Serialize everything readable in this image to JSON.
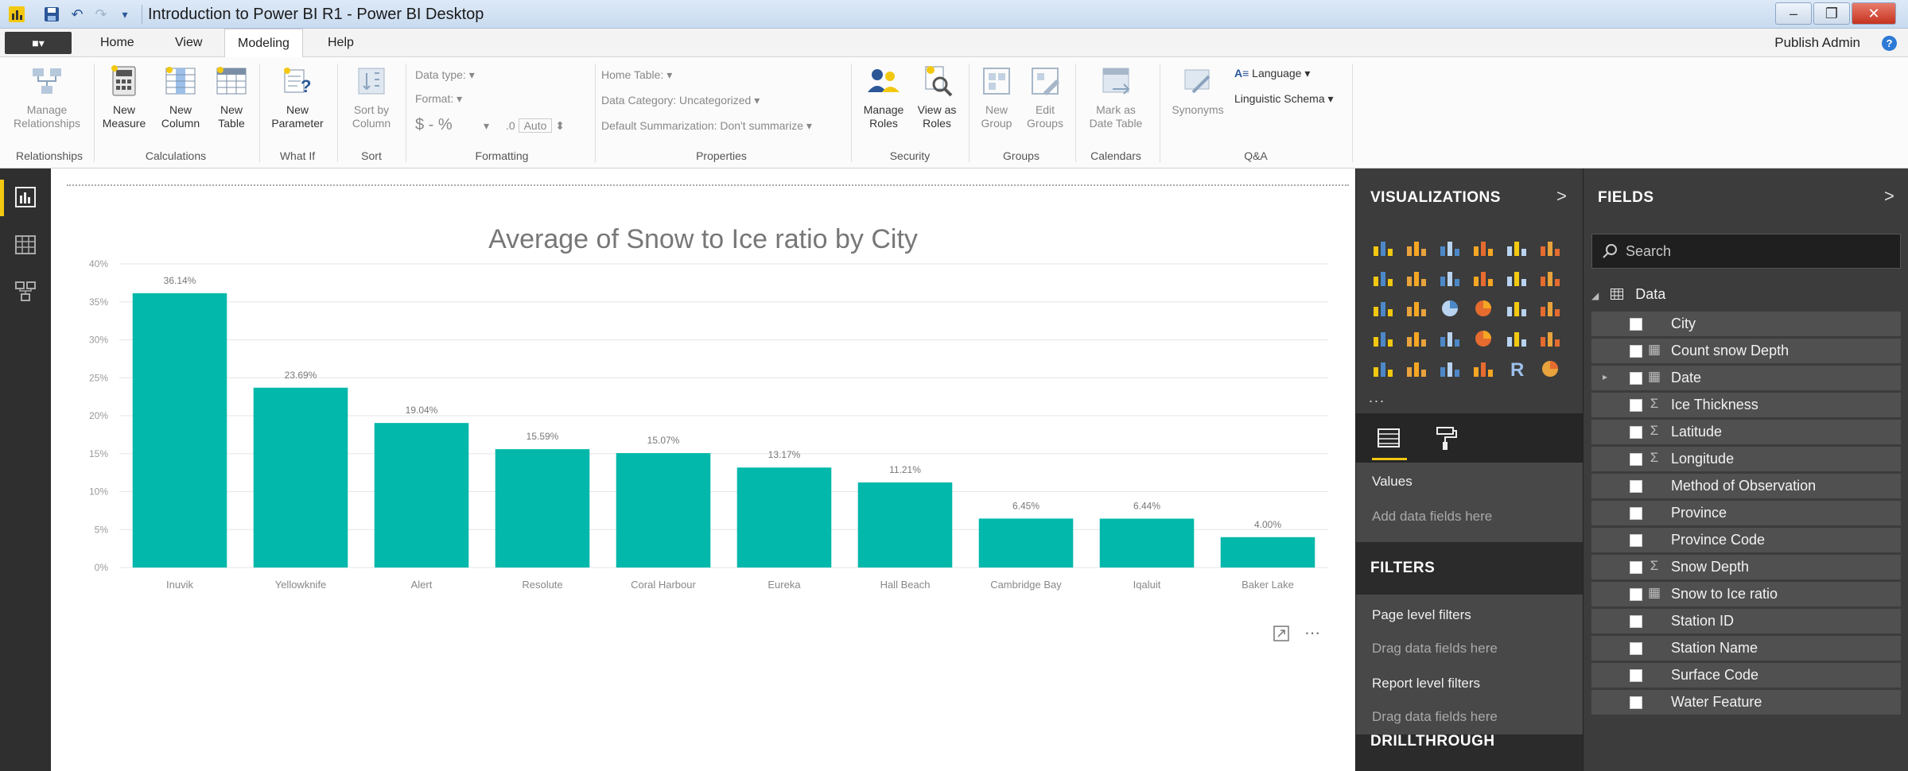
{
  "window": {
    "title": "Introduction to Power BI R1 - Power BI Desktop"
  },
  "menu": {
    "file_label": "■▾",
    "tabs": [
      {
        "label": "Home",
        "active": false
      },
      {
        "label": "View",
        "active": false
      },
      {
        "label": "Modeling",
        "active": true
      },
      {
        "label": "Help",
        "active": false
      }
    ],
    "publisher": "Publish Admin",
    "help_glyph": "?"
  },
  "ribbon": {
    "buttons": {
      "manage_relationships": "Manage\nRelationships",
      "new_measure": "New\nMeasure",
      "new_column": "New\nColumn",
      "new_table": "New\nTable",
      "new_parameter": "New\nParameter",
      "sort_by_column": "Sort by\nColumn",
      "manage_roles": "Manage\nRoles",
      "view_as_roles": "View as\nRoles",
      "new_group": "New\nGroup",
      "edit_groups": "Edit\nGroups",
      "mark_as_date_table": "Mark as\nDate Table",
      "synonyms": "Synonyms",
      "language": "Language",
      "linguistic_schema": "Linguistic Schema"
    },
    "formatting": {
      "data_type": "Data type:",
      "format": "Format:",
      "currency": "$ - %",
      "auto": "Auto"
    },
    "properties": {
      "home_table": "Home Table:",
      "data_category": "Data Category: Uncategorized",
      "default_summarization": "Default Summarization: Don't summarize"
    },
    "groups": {
      "relationships": "Relationships",
      "calculations": "Calculations",
      "what_if": "What If",
      "sort": "Sort",
      "formatting": "Formatting",
      "properties": "Properties",
      "security": "Security",
      "groups": "Groups",
      "calendars": "Calendars",
      "qa": "Q&A"
    }
  },
  "chart_data": {
    "type": "bar",
    "title": "Average of Snow to Ice ratio by City",
    "categories": [
      "Inuvik",
      "Yellowknife",
      "Alert",
      "Resolute",
      "Coral Harbour",
      "Eureka",
      "Hall Beach",
      "Cambridge Bay",
      "Iqaluit",
      "Baker Lake"
    ],
    "values": [
      36.14,
      23.69,
      19.04,
      15.59,
      15.07,
      13.17,
      11.21,
      6.45,
      6.44,
      4.0
    ],
    "data_labels": [
      "36.14%",
      "23.69%",
      "19.04%",
      "15.59%",
      "15.07%",
      "13.17%",
      "11.21%",
      "6.45%",
      "6.44%",
      "4.00%"
    ],
    "y_ticks": [
      0,
      5,
      10,
      15,
      20,
      25,
      30,
      35,
      40
    ],
    "y_tick_labels": [
      "0%",
      "5%",
      "10%",
      "15%",
      "20%",
      "25%",
      "30%",
      "35%",
      "40%"
    ],
    "ylim": [
      0,
      40
    ],
    "grid": true,
    "bar_color": "#01b8aa"
  },
  "visualizations": {
    "header": "VISUALIZATIONS",
    "chevron": ">",
    "more": "...",
    "values_label": "Values",
    "values_hint": "Add data fields here",
    "filters_header": "FILTERS",
    "page_filters": "Page level filters",
    "page_filters_hint": "Drag data fields here",
    "report_filters": "Report level filters",
    "report_filters_hint": "Drag data fields here",
    "drillthrough_header": "DRILLTHROUGH"
  },
  "fields": {
    "header": "FIELDS",
    "chevron": ">",
    "search_placeholder": "Search",
    "table_name": "Data",
    "items": [
      {
        "name": "City",
        "type": "",
        "expandable": false
      },
      {
        "name": "Count snow Depth",
        "type": "calc",
        "expandable": false
      },
      {
        "name": "Date",
        "type": "date",
        "expandable": true
      },
      {
        "name": "Ice Thickness",
        "type": "sum",
        "expandable": false
      },
      {
        "name": "Latitude",
        "type": "sum",
        "expandable": false
      },
      {
        "name": "Longitude",
        "type": "sum",
        "expandable": false
      },
      {
        "name": "Method of Observation",
        "type": "",
        "expandable": false
      },
      {
        "name": "Province",
        "type": "",
        "expandable": false
      },
      {
        "name": "Province Code",
        "type": "",
        "expandable": false
      },
      {
        "name": "Snow Depth",
        "type": "sum",
        "expandable": false
      },
      {
        "name": "Snow to Ice ratio",
        "type": "measure",
        "expandable": false
      },
      {
        "name": "Station ID",
        "type": "",
        "expandable": false
      },
      {
        "name": "Station Name",
        "type": "",
        "expandable": false
      },
      {
        "name": "Surface Code",
        "type": "",
        "expandable": false
      },
      {
        "name": "Water Feature",
        "type": "",
        "expandable": false
      }
    ]
  },
  "colors": {
    "accent": "#f2c811",
    "bar": "#01b8aa",
    "pane_bg": "#3c3c3c"
  }
}
